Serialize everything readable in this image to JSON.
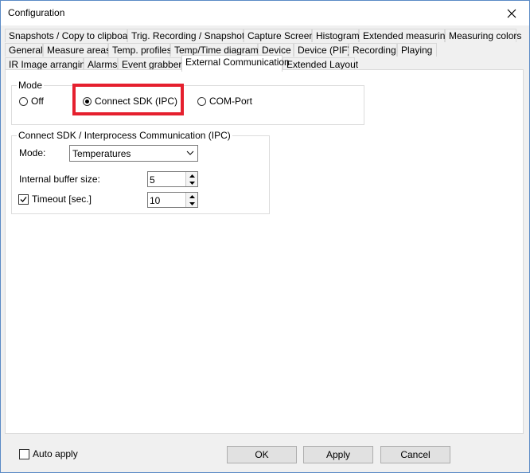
{
  "window": {
    "title": "Configuration"
  },
  "tabs": {
    "row1": [
      "Snapshots / Copy to clipboard",
      "Trig. Recording / Snapshots",
      "Capture Screen",
      "Histogram",
      "Extended measuring",
      "Measuring colors"
    ],
    "row2": [
      "General",
      "Measure areas",
      "Temp. profiles",
      "Temp/Time diagram",
      "Device",
      "Device (PIF)",
      "Recording",
      "Playing"
    ],
    "row3": [
      "IR Image arranging",
      "Alarms",
      "Event grabber",
      "External Communication",
      "Extended Layout"
    ],
    "active": "External Communication"
  },
  "mode_group": {
    "legend": "Mode",
    "options": [
      "Off",
      "Connect SDK (IPC)",
      "COM-Port"
    ],
    "selected": "Connect SDK (IPC)"
  },
  "ipc_group": {
    "legend": "Connect SDK / Interprocess Communication (IPC)",
    "mode_label": "Mode:",
    "mode_value": "Temperatures",
    "buffer_label": "Internal buffer size:",
    "buffer_value": "5",
    "timeout_label": "Timeout [sec.]",
    "timeout_checked": true,
    "timeout_value": "10"
  },
  "footer": {
    "auto_apply_label": "Auto apply",
    "auto_apply_checked": false,
    "ok_label": "OK",
    "apply_label": "Apply",
    "cancel_label": "Cancel"
  },
  "colors": {
    "highlight": "#e5202e",
    "border": "#5a8ac6"
  },
  "icons": {
    "close": "close-icon",
    "dropdown": "chevron-down-icon",
    "spin_up": "arrow-up-icon",
    "spin_down": "arrow-down-icon"
  }
}
